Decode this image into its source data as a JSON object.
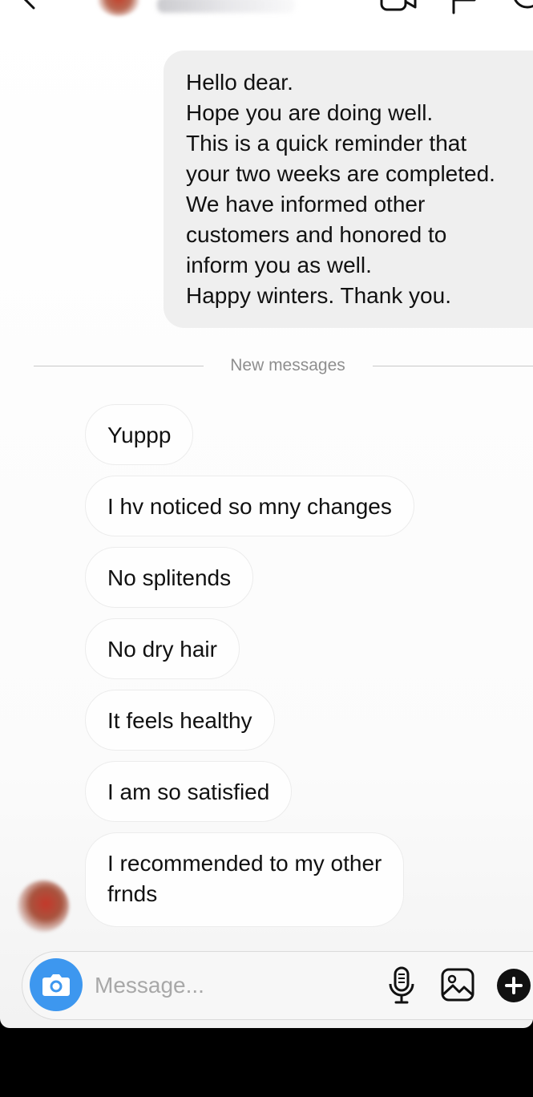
{
  "outgoing_message": {
    "text": "Hello dear.\nHope you are doing well.\nThis is a quick reminder that\nyour two weeks are completed.\nWe have informed other\ncustomers and honored to\ninform you as well.\nHappy winters. Thank you."
  },
  "divider": {
    "label": "New messages"
  },
  "incoming_messages": [
    {
      "text": "Yuppp"
    },
    {
      "text": "I hv noticed so mny changes"
    },
    {
      "text": "No splitends"
    },
    {
      "text": "No dry hair"
    },
    {
      "text": "It feels healthy"
    },
    {
      "text": "I am so satisfied"
    },
    {
      "text": "I recommended to my other\nfrnds"
    }
  ],
  "composer": {
    "placeholder": "Message...",
    "camera_icon": "camera-icon",
    "mic_icon": "microphone-icon",
    "gallery_icon": "gallery-icon",
    "plus_icon": "plus-icon",
    "camera_color": "#3d97ef"
  },
  "header": {
    "back_icon": "back-arrow-icon",
    "video_icon": "video-call-icon",
    "flag_icon": "flag-icon",
    "info_icon": "info-icon"
  }
}
